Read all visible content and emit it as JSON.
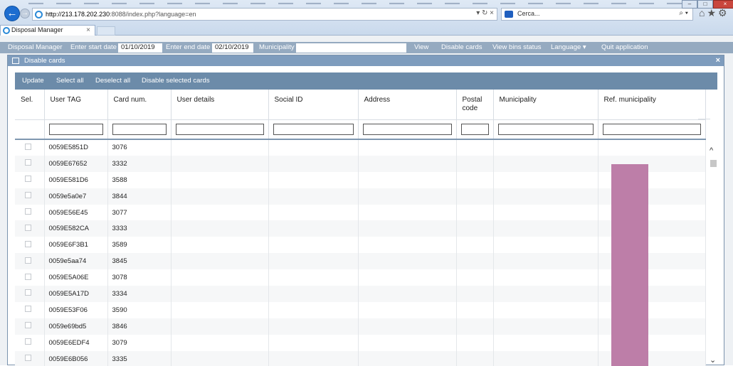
{
  "browser": {
    "url_host": "http://213.178.202.230",
    "url_rest": ":8088/index.php?language=en",
    "search_placeholder": "Cerca...",
    "tab_title": "Disposal Manager",
    "tab_close": "×",
    "back_glyph": "←",
    "fwd_glyph": "→",
    "refresh_glyphs": "▾ ↻ ×",
    "search_glyph": "⌕ ▾",
    "tool_glyphs": "⌂★⚙",
    "win_min": "–",
    "win_max": "□",
    "win_close": "×"
  },
  "menubar": {
    "app_name": "Disposal Manager",
    "start_label": "Enter start date",
    "start_value": "01/10/2019",
    "end_label": "Enter end date",
    "end_value": "02/10/2019",
    "municipality_label": "Municipality",
    "view": "View",
    "disable_cards": "Disable cards",
    "view_bins": "View bins status",
    "language": "Language",
    "language_caret": "▾",
    "quit": "Quit application"
  },
  "dialog": {
    "title": "Disable cards",
    "close_glyph": "×",
    "toolbar": {
      "update": "Update",
      "select_all": "Select all",
      "deselect_all": "Deselect all",
      "disable_selected": "Disable selected cards"
    },
    "columns": [
      "Sel.",
      "User TAG",
      "Card num.",
      "User details",
      "Social ID",
      "Address",
      "Postal code",
      "Municipality",
      "Ref. municipality"
    ],
    "rows": [
      {
        "tag": "0059E5851D",
        "card": "3076"
      },
      {
        "tag": "0059E67652",
        "card": "3332"
      },
      {
        "tag": "0059E581D6",
        "card": "3588"
      },
      {
        "tag": "0059e5a0e7",
        "card": "3844"
      },
      {
        "tag": "0059E56E45",
        "card": "3077"
      },
      {
        "tag": "0059E582CA",
        "card": "3333"
      },
      {
        "tag": "0059E6F3B1",
        "card": "3589"
      },
      {
        "tag": "0059e5aa74",
        "card": "3845"
      },
      {
        "tag": "0059E5A06E",
        "card": "3078"
      },
      {
        "tag": "0059E5A17D",
        "card": "3334"
      },
      {
        "tag": "0059E53F06",
        "card": "3590"
      },
      {
        "tag": "0059e69bd5",
        "card": "3846"
      },
      {
        "tag": "0059E6EDF4",
        "card": "3079"
      },
      {
        "tag": "0059E6B056",
        "card": "3335"
      }
    ],
    "scroll_up": "^",
    "scroll_down": "⌄"
  },
  "colors": {
    "menubar": "#95aac0",
    "toolbar": "#6c8ba9",
    "dialog_title": "#7e9cbd",
    "ref_municipality_highlight": "#bd7ea8"
  }
}
